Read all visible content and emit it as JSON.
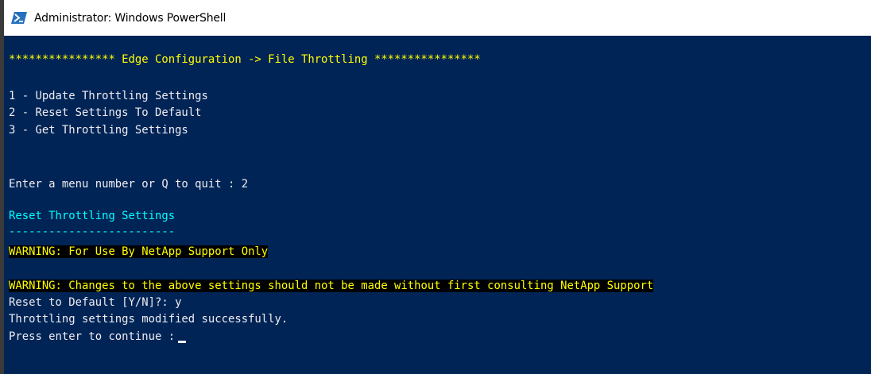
{
  "window": {
    "title": "Administrator: Windows PowerShell",
    "icon": "powershell-icon"
  },
  "colors": {
    "console_background": "#012456",
    "text": "#eeedf0",
    "header": "#ffff00",
    "section": "#00ffff",
    "warning_fg": "#ffff00",
    "warning_bg": "#000000"
  },
  "console": {
    "header": "**************** Edge Configuration -> File Throttling ****************",
    "menu": [
      "1 - Update Throttling Settings",
      "2 - Reset Settings To Default",
      "3 - Get Throttling Settings"
    ],
    "prompt": "Enter a menu number or Q to quit : 2",
    "section_title": "Reset Throttling Settings",
    "section_underline": "-------------------------",
    "warning_1": "WARNING: For Use By NetApp Support Only",
    "warning_2": "WARNING: Changes to the above settings should not be made without first consulting NetApp Support",
    "reset_prompt": "Reset to Default [Y/N]?: y",
    "result": "Throttling settings modified successfully.",
    "continue_prompt": "Press enter to continue :"
  }
}
